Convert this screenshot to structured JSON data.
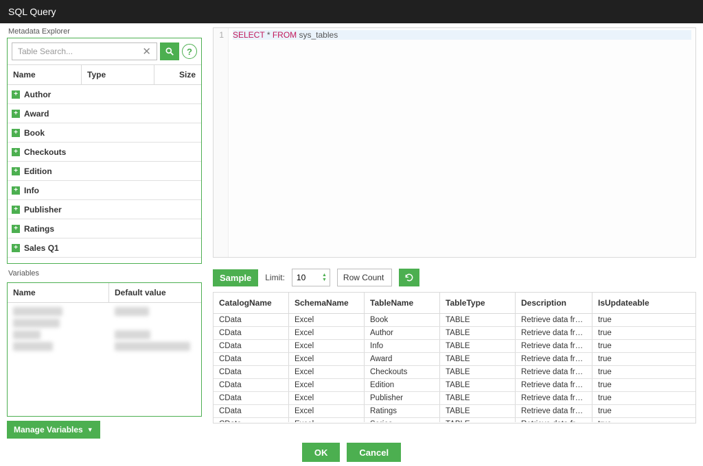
{
  "window": {
    "title": "SQL Query"
  },
  "explorer": {
    "label": "Metadata Explorer",
    "search_placeholder": "Table Search...",
    "columns": {
      "name": "Name",
      "type": "Type",
      "size": "Size"
    },
    "items": [
      {
        "label": "Author"
      },
      {
        "label": "Award"
      },
      {
        "label": "Book"
      },
      {
        "label": "Checkouts"
      },
      {
        "label": "Edition"
      },
      {
        "label": "Info"
      },
      {
        "label": "Publisher"
      },
      {
        "label": "Ratings"
      },
      {
        "label": "Sales Q1"
      }
    ]
  },
  "variables": {
    "label": "Variables",
    "columns": {
      "name": "Name",
      "default": "Default value"
    },
    "manage_label": "Manage Variables"
  },
  "editor": {
    "line_no": "1",
    "tokens": {
      "select": "SELECT",
      "star": "*",
      "from": "FROM",
      "ident": "sys_tables"
    }
  },
  "sample": {
    "badge": "Sample",
    "limit_label": "Limit:",
    "limit_value": "10",
    "rowcount_label": "Row Count"
  },
  "results": {
    "columns": [
      "CatalogName",
      "SchemaName",
      "TableName",
      "TableType",
      "Description",
      "IsUpdateable"
    ],
    "rows": [
      [
        "CData",
        "Excel",
        "Book",
        "TABLE",
        "Retrieve data from t...",
        "true"
      ],
      [
        "CData",
        "Excel",
        "Author",
        "TABLE",
        "Retrieve data from t...",
        "true"
      ],
      [
        "CData",
        "Excel",
        "Info",
        "TABLE",
        "Retrieve data from t...",
        "true"
      ],
      [
        "CData",
        "Excel",
        "Award",
        "TABLE",
        "Retrieve data from t...",
        "true"
      ],
      [
        "CData",
        "Excel",
        "Checkouts",
        "TABLE",
        "Retrieve data from t...",
        "true"
      ],
      [
        "CData",
        "Excel",
        "Edition",
        "TABLE",
        "Retrieve data from t...",
        "true"
      ],
      [
        "CData",
        "Excel",
        "Publisher",
        "TABLE",
        "Retrieve data from t...",
        "true"
      ],
      [
        "CData",
        "Excel",
        "Ratings",
        "TABLE",
        "Retrieve data from t...",
        "true"
      ],
      [
        "CData",
        "Excel",
        "Series",
        "TABLE",
        "Retrieve data from t...",
        "true"
      ]
    ]
  },
  "footer": {
    "ok": "OK",
    "cancel": "Cancel"
  },
  "colors": {
    "accent": "#4CAF50"
  }
}
